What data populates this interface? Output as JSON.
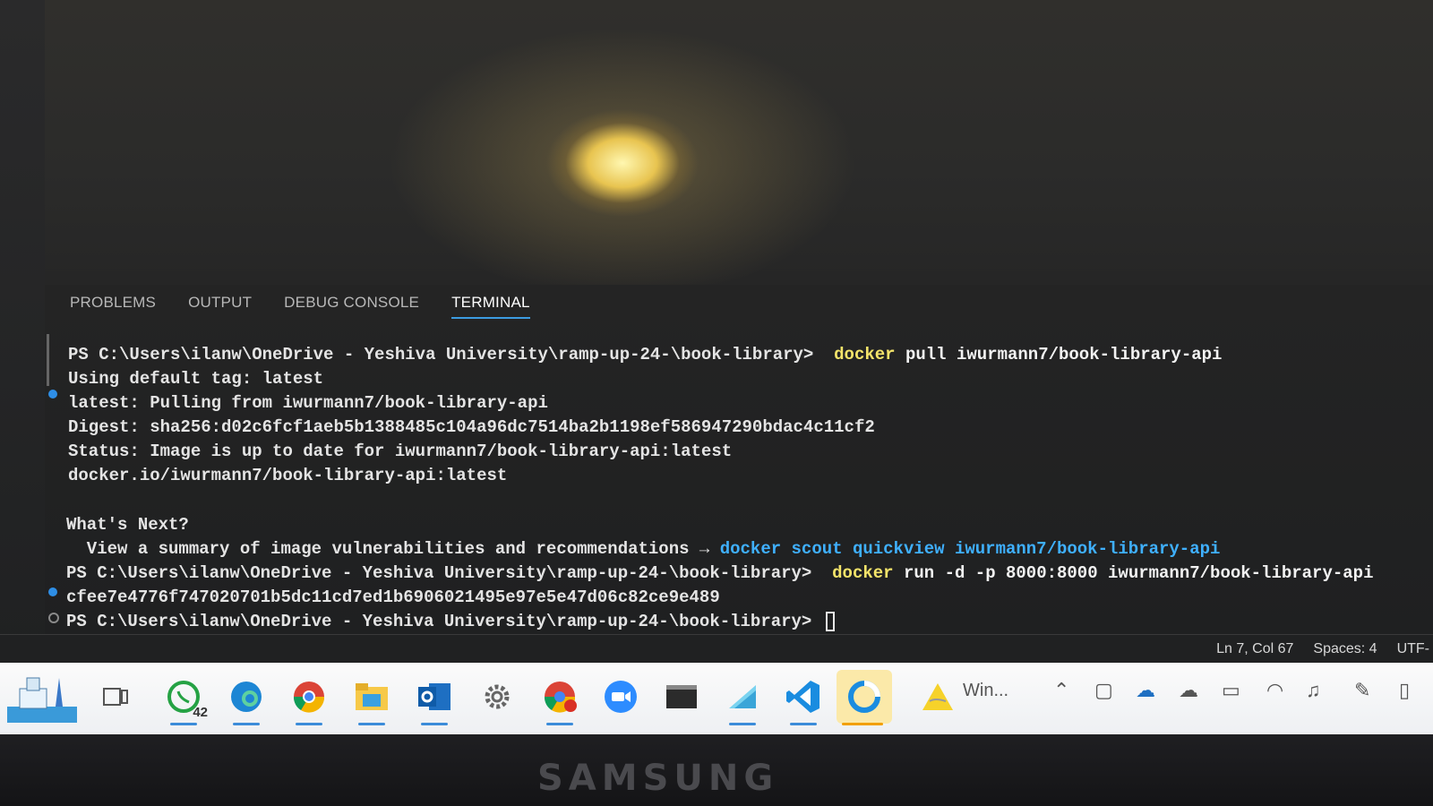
{
  "panel": {
    "tabs": [
      {
        "label": "PROBLEMS"
      },
      {
        "label": "OUTPUT"
      },
      {
        "label": "DEBUG CONSOLE"
      },
      {
        "label": "TERMINAL",
        "active": true
      }
    ]
  },
  "terminal": {
    "prompt": "PS C:\\Users\\ilanw\\OneDrive - Yeshiva University\\ramp-up-24-\\book-library>",
    "line1_cmd_word": "docker",
    "line1_cmd_rest": " pull iwurmann7/book-library-api",
    "line2": "Using default tag: latest",
    "line3": "latest: Pulling from iwurmann7/book-library-api",
    "line4": "Digest: sha256:d02c6fcf1aeb5b1388485c104a96dc7514ba2b1198ef586947290bdac4c11cf2",
    "line5": "Status: Image is up to date for iwurmann7/book-library-api:latest",
    "line6": "docker.io/iwurmann7/book-library-api:latest",
    "whats_next": "What's Next?",
    "summary_text": "  View a summary of image vulnerabilities and recommendations → ",
    "summary_cmd": "docker scout quickview iwurmann7/book-library-api",
    "line_run_cmd_word": "docker",
    "line_run_cmd_rest": " run -d -p 8000:8000 iwurmann7/book-library-api",
    "container_id": "cfee7e4776f747020701b5dc11cd7ed1b6906021495e97e5e47d06c82ce9e489"
  },
  "statusbar": {
    "position": "Ln 7, Col 67",
    "spaces": "Spaces: 4",
    "encoding": "UTF-"
  },
  "taskbar": {
    "whatsapp_badge": "42",
    "search_label": "Win..."
  },
  "monitor": {
    "brand": "SAMSUNG"
  },
  "colors": {
    "terminal_yellow": "#f4e46a",
    "terminal_blue": "#3fb0ff",
    "active_tab_underline": "#3c9be0"
  }
}
